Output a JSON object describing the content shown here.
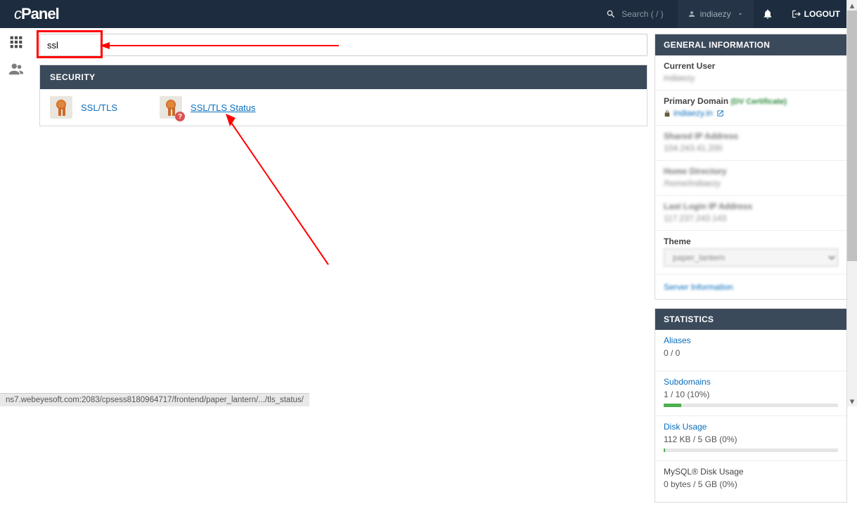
{
  "topbar": {
    "logo_prefix": "c",
    "logo_name": "Panel",
    "search_placeholder": "Search ( / )",
    "username": "indiaezy",
    "logout": "LOGOUT"
  },
  "search": {
    "value": "ssl"
  },
  "group": {
    "title": "SECURITY",
    "items": [
      {
        "label": "SSL/TLS"
      },
      {
        "label": "SSL/TLS Status"
      }
    ]
  },
  "general_info": {
    "title": "GENERAL INFORMATION",
    "current_user_label": "Current User",
    "current_user": "indiaezy",
    "primary_domain_label": "Primary Domain",
    "dv_cert": "(DV Certificate)",
    "primary_domain": "indiaezy.in",
    "shared_ip_label": "Shared IP Address",
    "shared_ip": "104.243.41.200",
    "home_dir_label": "Home Directory",
    "home_dir": "/home/indiaezy",
    "last_login_label": "Last Login IP Address",
    "last_login": "117.237.243.143",
    "theme_label": "Theme",
    "theme": "paper_lantern",
    "server_info": "Server Information"
  },
  "stats": {
    "title": "STATISTICS",
    "aliases_label": "Aliases",
    "aliases_val": "0 / 0",
    "subdomains_label": "Subdomains",
    "subdomains_val": "1 / 10   (10%)",
    "subdomains_pct": 10,
    "disk_label": "Disk Usage",
    "disk_val": "112 KB / 5 GB   (0%)",
    "disk_pct": 1,
    "mysql_label": "MySQL® Disk Usage",
    "mysql_val": "0 bytes / 5 GB   (0%)"
  },
  "statusbar": "ns7.webeyesoft.com:2083/cpsess8180964717/frontend/paper_lantern/.../tls_status/"
}
